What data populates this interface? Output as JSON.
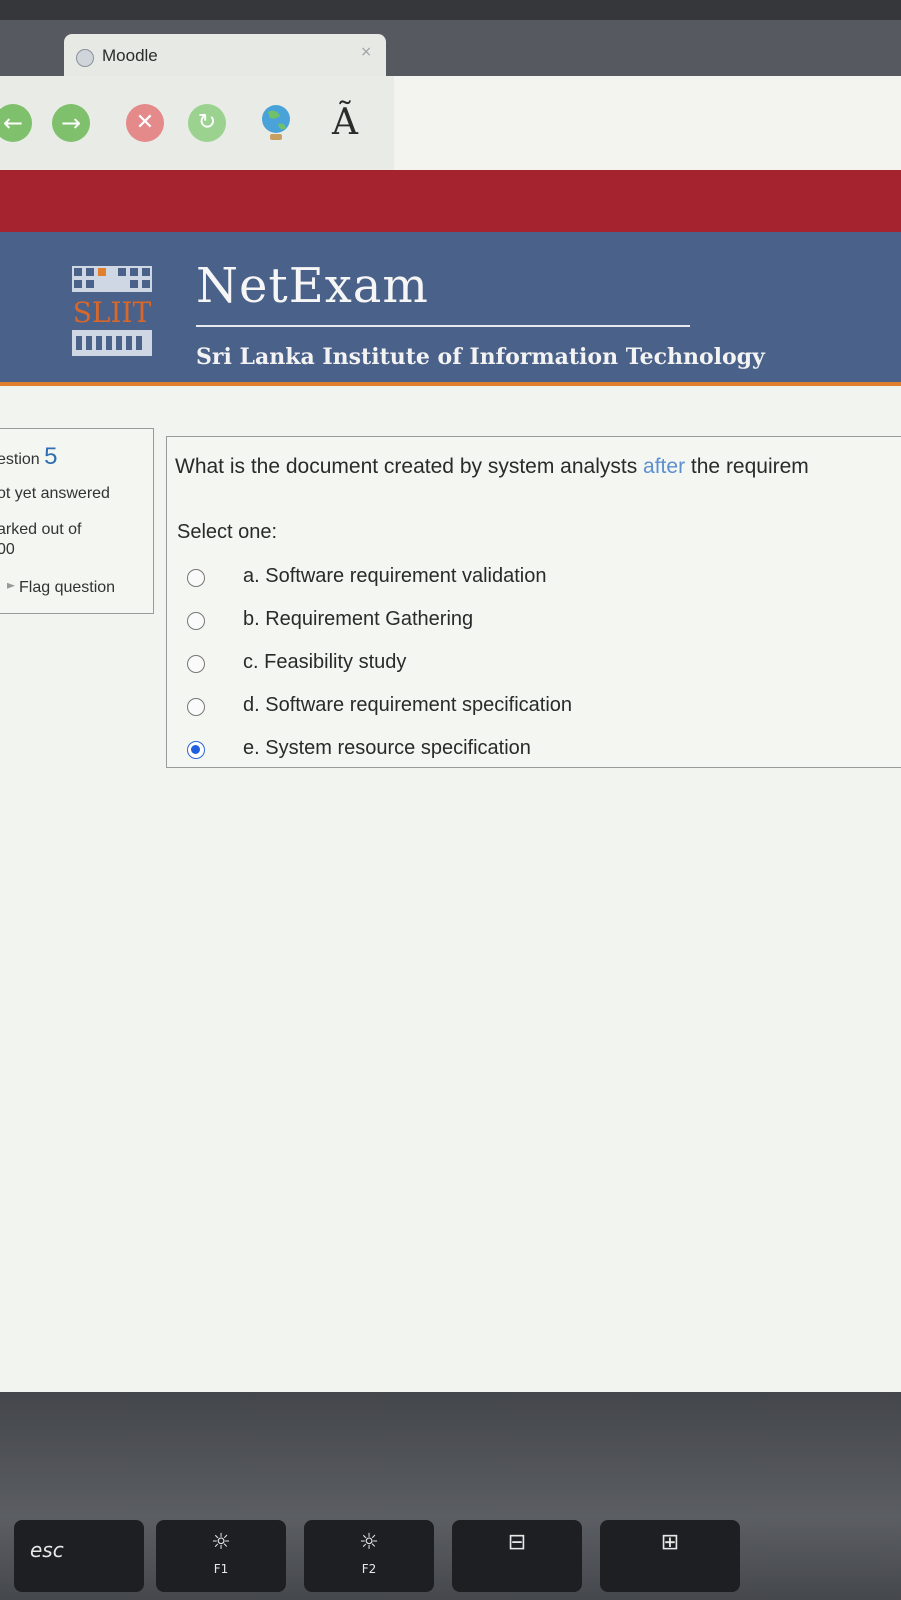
{
  "browser": {
    "tab_title": "Moodle",
    "tab_close": "×",
    "toolbar_char": "Ã"
  },
  "header": {
    "logo_text": "SLIIT",
    "title": "NetExam",
    "institute": "Sri Lanka Institute of Information Technology"
  },
  "question_info": {
    "number_prefix": "estion",
    "number": "5",
    "state": "ot yet answered",
    "marked_line1": "arked out of",
    "marked_line2": "00",
    "flag_label": "Flag question"
  },
  "question": {
    "text_before": "What is the document created by system analysts ",
    "text_accent": "after",
    "text_after": " the requirem",
    "select_label": "Select one:",
    "answers": [
      {
        "label": "a. Software requirement validation",
        "checked": false
      },
      {
        "label": "b. Requirement Gathering",
        "checked": false
      },
      {
        "label": "c. Feasibility study",
        "checked": false
      },
      {
        "label": "d. Software requirement specification",
        "checked": false
      },
      {
        "label": "e. System resource specification",
        "checked": true
      }
    ]
  },
  "keyboard": {
    "esc": "esc",
    "f1_glyph": "☼",
    "f1": "F1",
    "f2_glyph": "☼",
    "f2": "F2",
    "f3_glyph": "⊟",
    "f4_glyph": "⊞"
  },
  "colors": {
    "header_bg": "#4a6189",
    "red_band": "#a4232e",
    "accent_orange": "#e0802f",
    "question_number": "#2f6fb1",
    "radio_selected": "#1f5fe0"
  }
}
